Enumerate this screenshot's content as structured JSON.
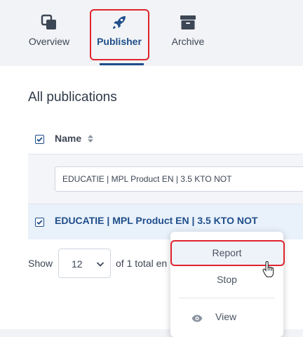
{
  "tabs": [
    {
      "label": "Overview",
      "icon": "copy-icon"
    },
    {
      "label": "Publisher",
      "icon": "rocket-icon",
      "active": true
    },
    {
      "label": "Archive",
      "icon": "archive-box-icon"
    }
  ],
  "page": {
    "title": "All publications"
  },
  "table": {
    "column_name": "Name",
    "filter_value": "EDUCATIE | MPL Product EN | 3.5 KTO NOT",
    "rows": [
      {
        "name": "EDUCATIE | MPL Product EN | 3.5 KTO NOT",
        "checked": true
      }
    ]
  },
  "pagination": {
    "show_label": "Show",
    "page_size": "12",
    "total_text": "of 1 total en"
  },
  "context_menu": {
    "items": [
      {
        "label": "Report",
        "highlighted": true
      },
      {
        "label": "Stop"
      },
      {
        "label": "View",
        "icon": "eye-icon"
      }
    ]
  },
  "colors": {
    "accent": "#1f4e8a",
    "highlight_outline": "#e0242e",
    "row_selected": "#e9f1fb",
    "background": "#f1f3f6"
  }
}
